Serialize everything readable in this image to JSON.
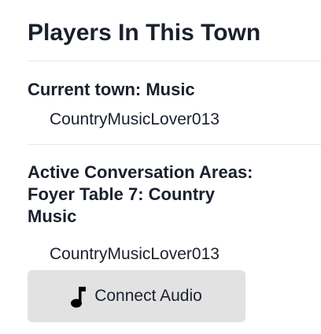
{
  "panel": {
    "title": "Players In This Town"
  },
  "current_town": {
    "heading": "Current town: Music",
    "players": [
      "CountryMusicLover013"
    ]
  },
  "active_areas": {
    "heading_line1": "Active Conversation Areas:",
    "heading_line2": "Foyer Table 7: Country",
    "heading_line3": "Music",
    "players": [
      "CountryMusicLover013"
    ]
  },
  "audio": {
    "connect_label": "Connect Audio",
    "icon": "music-note-icon"
  }
}
